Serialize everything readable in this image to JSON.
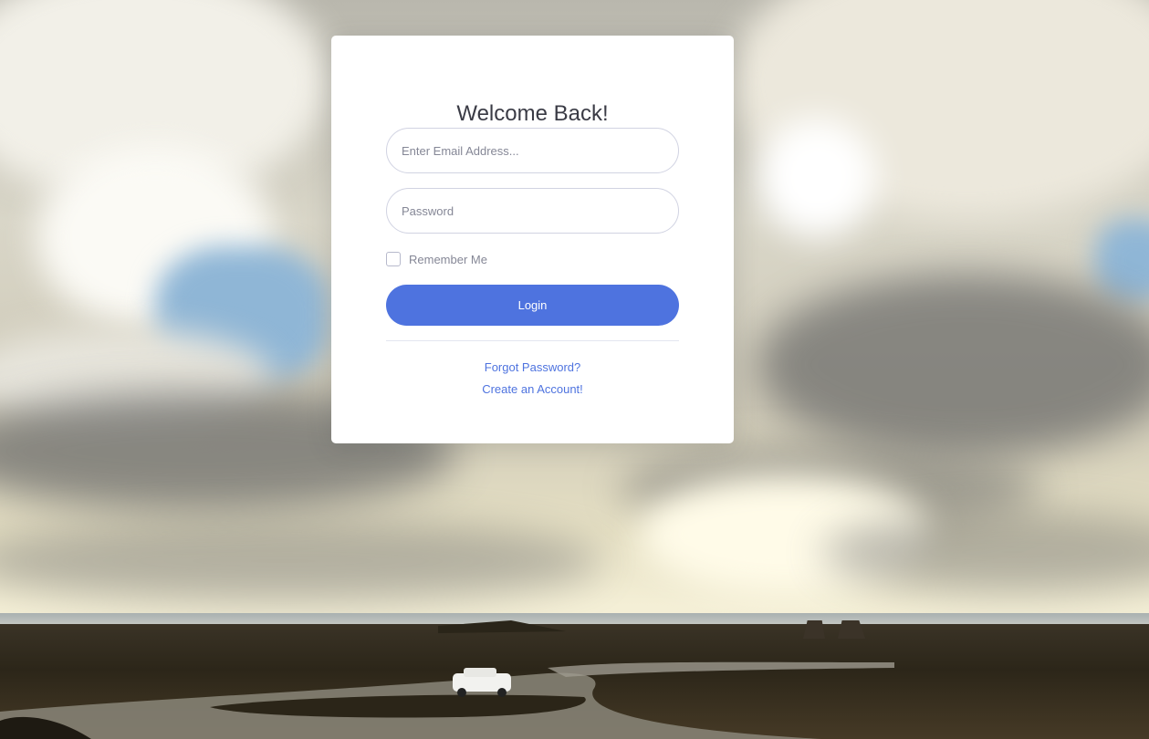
{
  "login_card": {
    "title": "Welcome Back!",
    "email_placeholder": "Enter Email Address...",
    "password_placeholder": "Password",
    "remember_label": "Remember Me",
    "remember_checked": false,
    "login_label": "Login",
    "forgot_link": "Forgot Password?",
    "create_link": "Create an Account!"
  },
  "colors": {
    "primary": "#4e73df",
    "card_background": "#ffffff",
    "title_text": "#3a3b45",
    "muted_text": "#858796",
    "input_border": "#d1d3e2"
  }
}
